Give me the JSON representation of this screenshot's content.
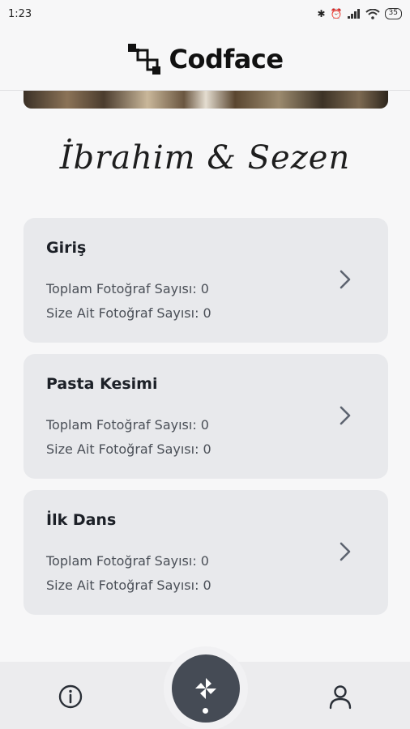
{
  "status_bar": {
    "time": "1:23",
    "battery": "35"
  },
  "header": {
    "logo_text": "Codface"
  },
  "couple_name": "İbrahim & Sezen",
  "albums": [
    {
      "title": "Giriş",
      "total_label": "Toplam Fotoğraf Sayısı: 0",
      "own_label": "Size Ait Fotoğraf Sayısı: 0"
    },
    {
      "title": "Pasta Kesimi",
      "total_label": "Toplam Fotoğraf Sayısı: 0",
      "own_label": "Size Ait Fotoğraf Sayısı: 0"
    },
    {
      "title": "İlk Dans",
      "total_label": "Toplam Fotoğraf Sayısı: 0",
      "own_label": "Size Ait Fotoğraf Sayısı: 0"
    }
  ],
  "bottom_nav": {
    "left_icon": "info-icon",
    "center_icon": "pinwheel-icon",
    "right_icon": "user-icon"
  },
  "colors": {
    "background": "#f7f7f8",
    "card": "#e8e9ec",
    "fab": "#454b55",
    "chevron": "#5d6470"
  }
}
